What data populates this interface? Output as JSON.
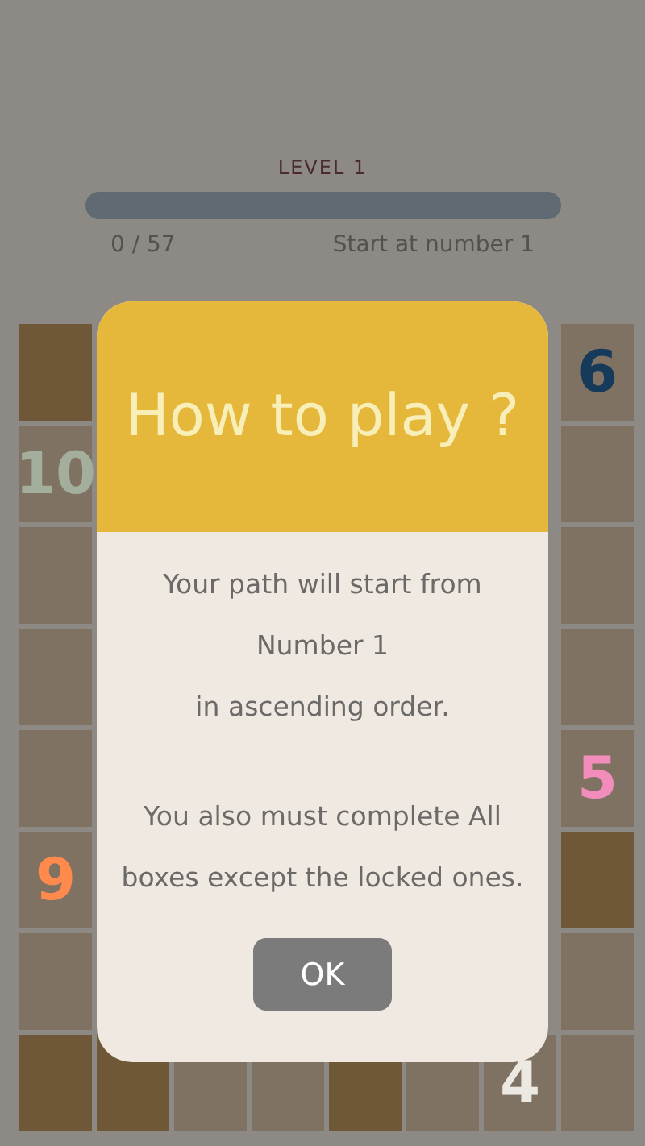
{
  "header": {
    "level_label": "LEVEL 1",
    "progress": {
      "level": 0
    },
    "count": "0 / 57",
    "hint": "Start at number 1"
  },
  "board": {
    "side_rows": [
      {
        "left": {
          "kind": "locked"
        },
        "right": {
          "kind": "number",
          "text": "6",
          "color": "#163a5a"
        }
      },
      {
        "left": {
          "kind": "number",
          "text": "10",
          "color": "#a3ae9c"
        },
        "right": {
          "kind": "empty"
        }
      },
      {
        "left": {
          "kind": "empty"
        },
        "right": {
          "kind": "empty"
        }
      },
      {
        "left": {
          "kind": "empty"
        },
        "right": {
          "kind": "empty"
        }
      },
      {
        "left": {
          "kind": "empty"
        },
        "right": {
          "kind": "number",
          "text": "5",
          "color": "#f28cbb"
        }
      },
      {
        "left": {
          "kind": "number",
          "text": "9",
          "color": "#ff8a4c"
        },
        "right": {
          "kind": "locked"
        }
      },
      {
        "left": {
          "kind": "empty"
        },
        "right": {
          "kind": "empty"
        }
      }
    ],
    "bottom_row": [
      {
        "kind": "locked"
      },
      {
        "kind": "locked"
      },
      {
        "kind": "empty"
      },
      {
        "kind": "empty"
      },
      {
        "kind": "locked"
      },
      {
        "kind": "empty"
      },
      {
        "kind": "number",
        "text": "4",
        "color": "#ece8e2"
      },
      {
        "kind": "empty"
      }
    ]
  },
  "dialog": {
    "title": "How to play ?",
    "paragraphs": [
      [
        "Your path will start from",
        "Number 1",
        "in ascending order."
      ],
      [
        "You also must complete All",
        "boxes except the locked ones."
      ]
    ],
    "button": "OK"
  }
}
